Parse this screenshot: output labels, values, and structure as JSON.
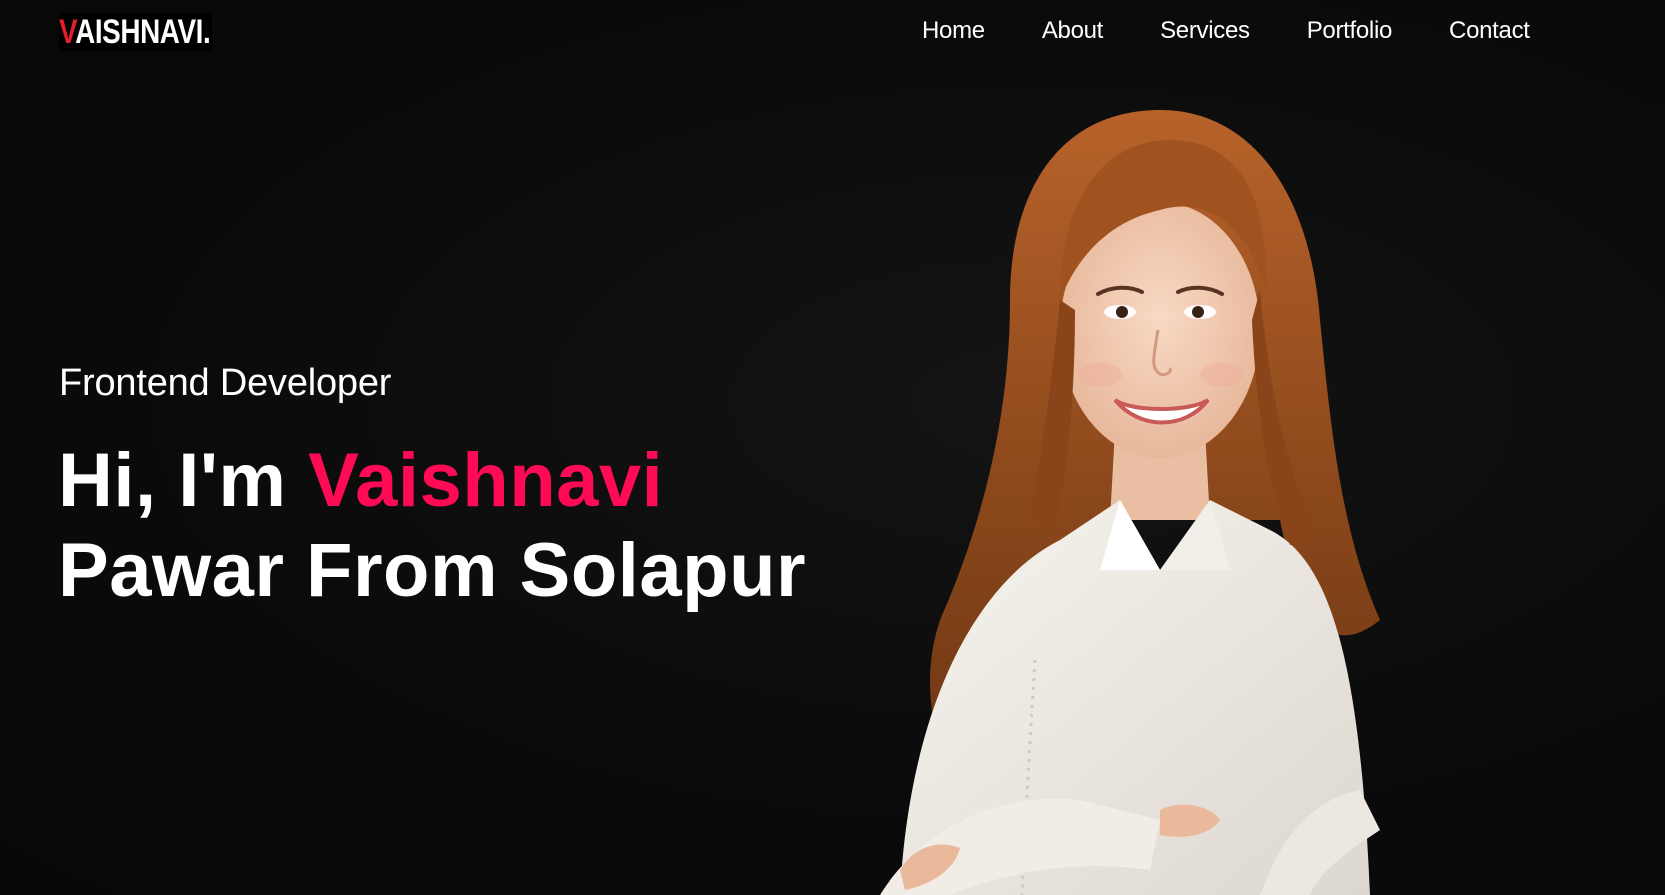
{
  "header": {
    "logo_first_letter": "V",
    "logo_rest": "AISHNAVI."
  },
  "nav": {
    "items": [
      "Home",
      "About",
      "Services",
      "Portfolio",
      "Contact"
    ]
  },
  "hero": {
    "role": "Frontend Developer",
    "greeting": "Hi, I'm",
    "name_highlight": "Vaishnavi",
    "line2": "Pawar From Solapur"
  },
  "colors": {
    "background": "#0a0a0a",
    "accent_pink": "#ff0a55",
    "logo_red": "#e0202a",
    "text": "#ffffff"
  }
}
